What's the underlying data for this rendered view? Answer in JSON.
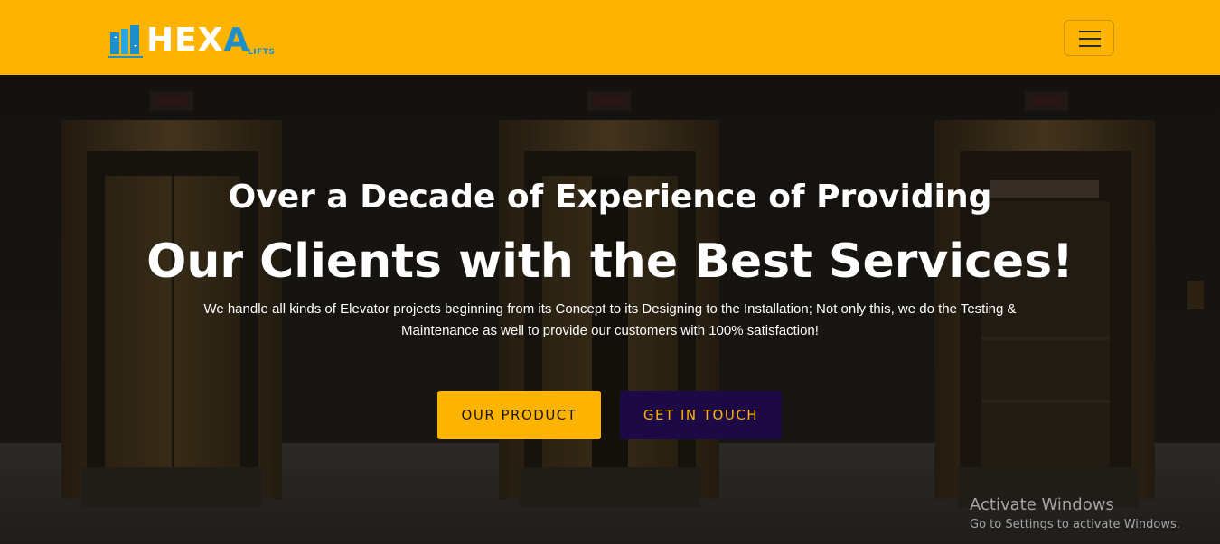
{
  "brand": {
    "logo_main": "HEX",
    "logo_accent": "A",
    "logo_sub": "LIFTS"
  },
  "nav": {
    "menu_icon": "hamburger-menu-icon"
  },
  "hero": {
    "line1": "Over a Decade of Experience of Providing",
    "line2": "Our Clients with the Best Services!",
    "description": "We handle all kinds of Elevator projects beginning from its Concept to its Designing to the Installation; Not only this, we do the Testing & Maintenance as well to provide our customers with 100% satisfaction!",
    "buttons": {
      "product": "OUR PRODUCT",
      "touch": "GET IN TOUCH"
    }
  },
  "watermark": {
    "title": "Activate Windows",
    "subtitle": "Go to Settings to activate Windows."
  },
  "colors": {
    "navbar": "#fdb301",
    "primary_button": "#fdb301",
    "secondary_button": "#1d0a45",
    "logo_blue": "#1e8ecb"
  }
}
